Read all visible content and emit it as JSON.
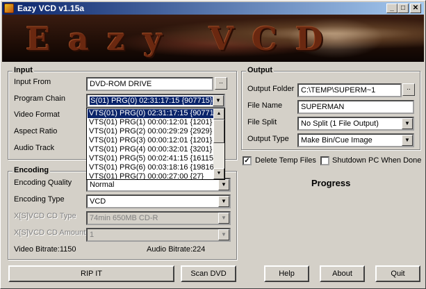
{
  "window": {
    "title": "Eazy VCD v1.15a",
    "controls": {
      "minimize": "_",
      "maximize": "□",
      "close": "✕"
    },
    "banner_text": "Eazy VCD"
  },
  "input": {
    "group_title": "Input",
    "input_from_label": "Input From",
    "input_from_value": "DVD-ROM DRIVE",
    "browse_label": "..",
    "program_chain_label": "Program Chain",
    "program_chain_value": "S(01) PRG(0) 02:31:17:15 {907715}",
    "video_format_label": "Video Format",
    "aspect_ratio_label": "Aspect Ratio",
    "audio_track_label": "Audio Track",
    "program_chain_options": [
      "VTS(01) PRG(0) 02:31:17:15 {907715}",
      "VTS(01) PRG(1) 00:00:12:01 {1201}",
      "VTS(01) PRG(2) 00:00:29:29 {2929}",
      "VTS(01) PRG(3) 00:00:12:01 {1201}",
      "VTS(01) PRG(4) 00:00:32:01 {3201}",
      "VTS(01) PRG(5) 00:02:41:15 {16115}",
      "VTS(01) PRG(6) 00:03:18:16 {19816}",
      "VTS(01) PRG(7) 00:00:27:00 {27}"
    ]
  },
  "encoding": {
    "group_title": "Encoding",
    "quality_label": "Encoding Quality",
    "quality_value": "Normal",
    "type_label": "Encoding Type",
    "type_value": "VCD",
    "cd_type_label": "X[S]VCD CD Type",
    "cd_type_value": "74min 650MB CD-R",
    "cd_amount_label": "X[S]VCD CD Amount",
    "cd_amount_value": "1",
    "video_bitrate": "Video Bitrate:1150",
    "audio_bitrate": "Audio Bitrate:224"
  },
  "output": {
    "group_title": "Output",
    "folder_label": "Output Folder",
    "folder_value": "C:\\TEMP\\SUPERM~1",
    "browse_label": "..",
    "file_name_label": "File Name",
    "file_name_value": "SUPERMAN",
    "file_split_label": "File Split",
    "file_split_value": "No Split (1 File Output)",
    "output_type_label": "Output Type",
    "output_type_value": "Make Bin/Cue Image"
  },
  "options": {
    "delete_temp_label": "Delete Temp Files",
    "delete_temp_checked": true,
    "shutdown_label": "Shutdown PC When Done",
    "shutdown_checked": false
  },
  "progress_label": "Progress",
  "buttons": {
    "rip": "RIP IT",
    "scan": "Scan DVD",
    "help": "Help",
    "about": "About",
    "quit": "Quit"
  }
}
